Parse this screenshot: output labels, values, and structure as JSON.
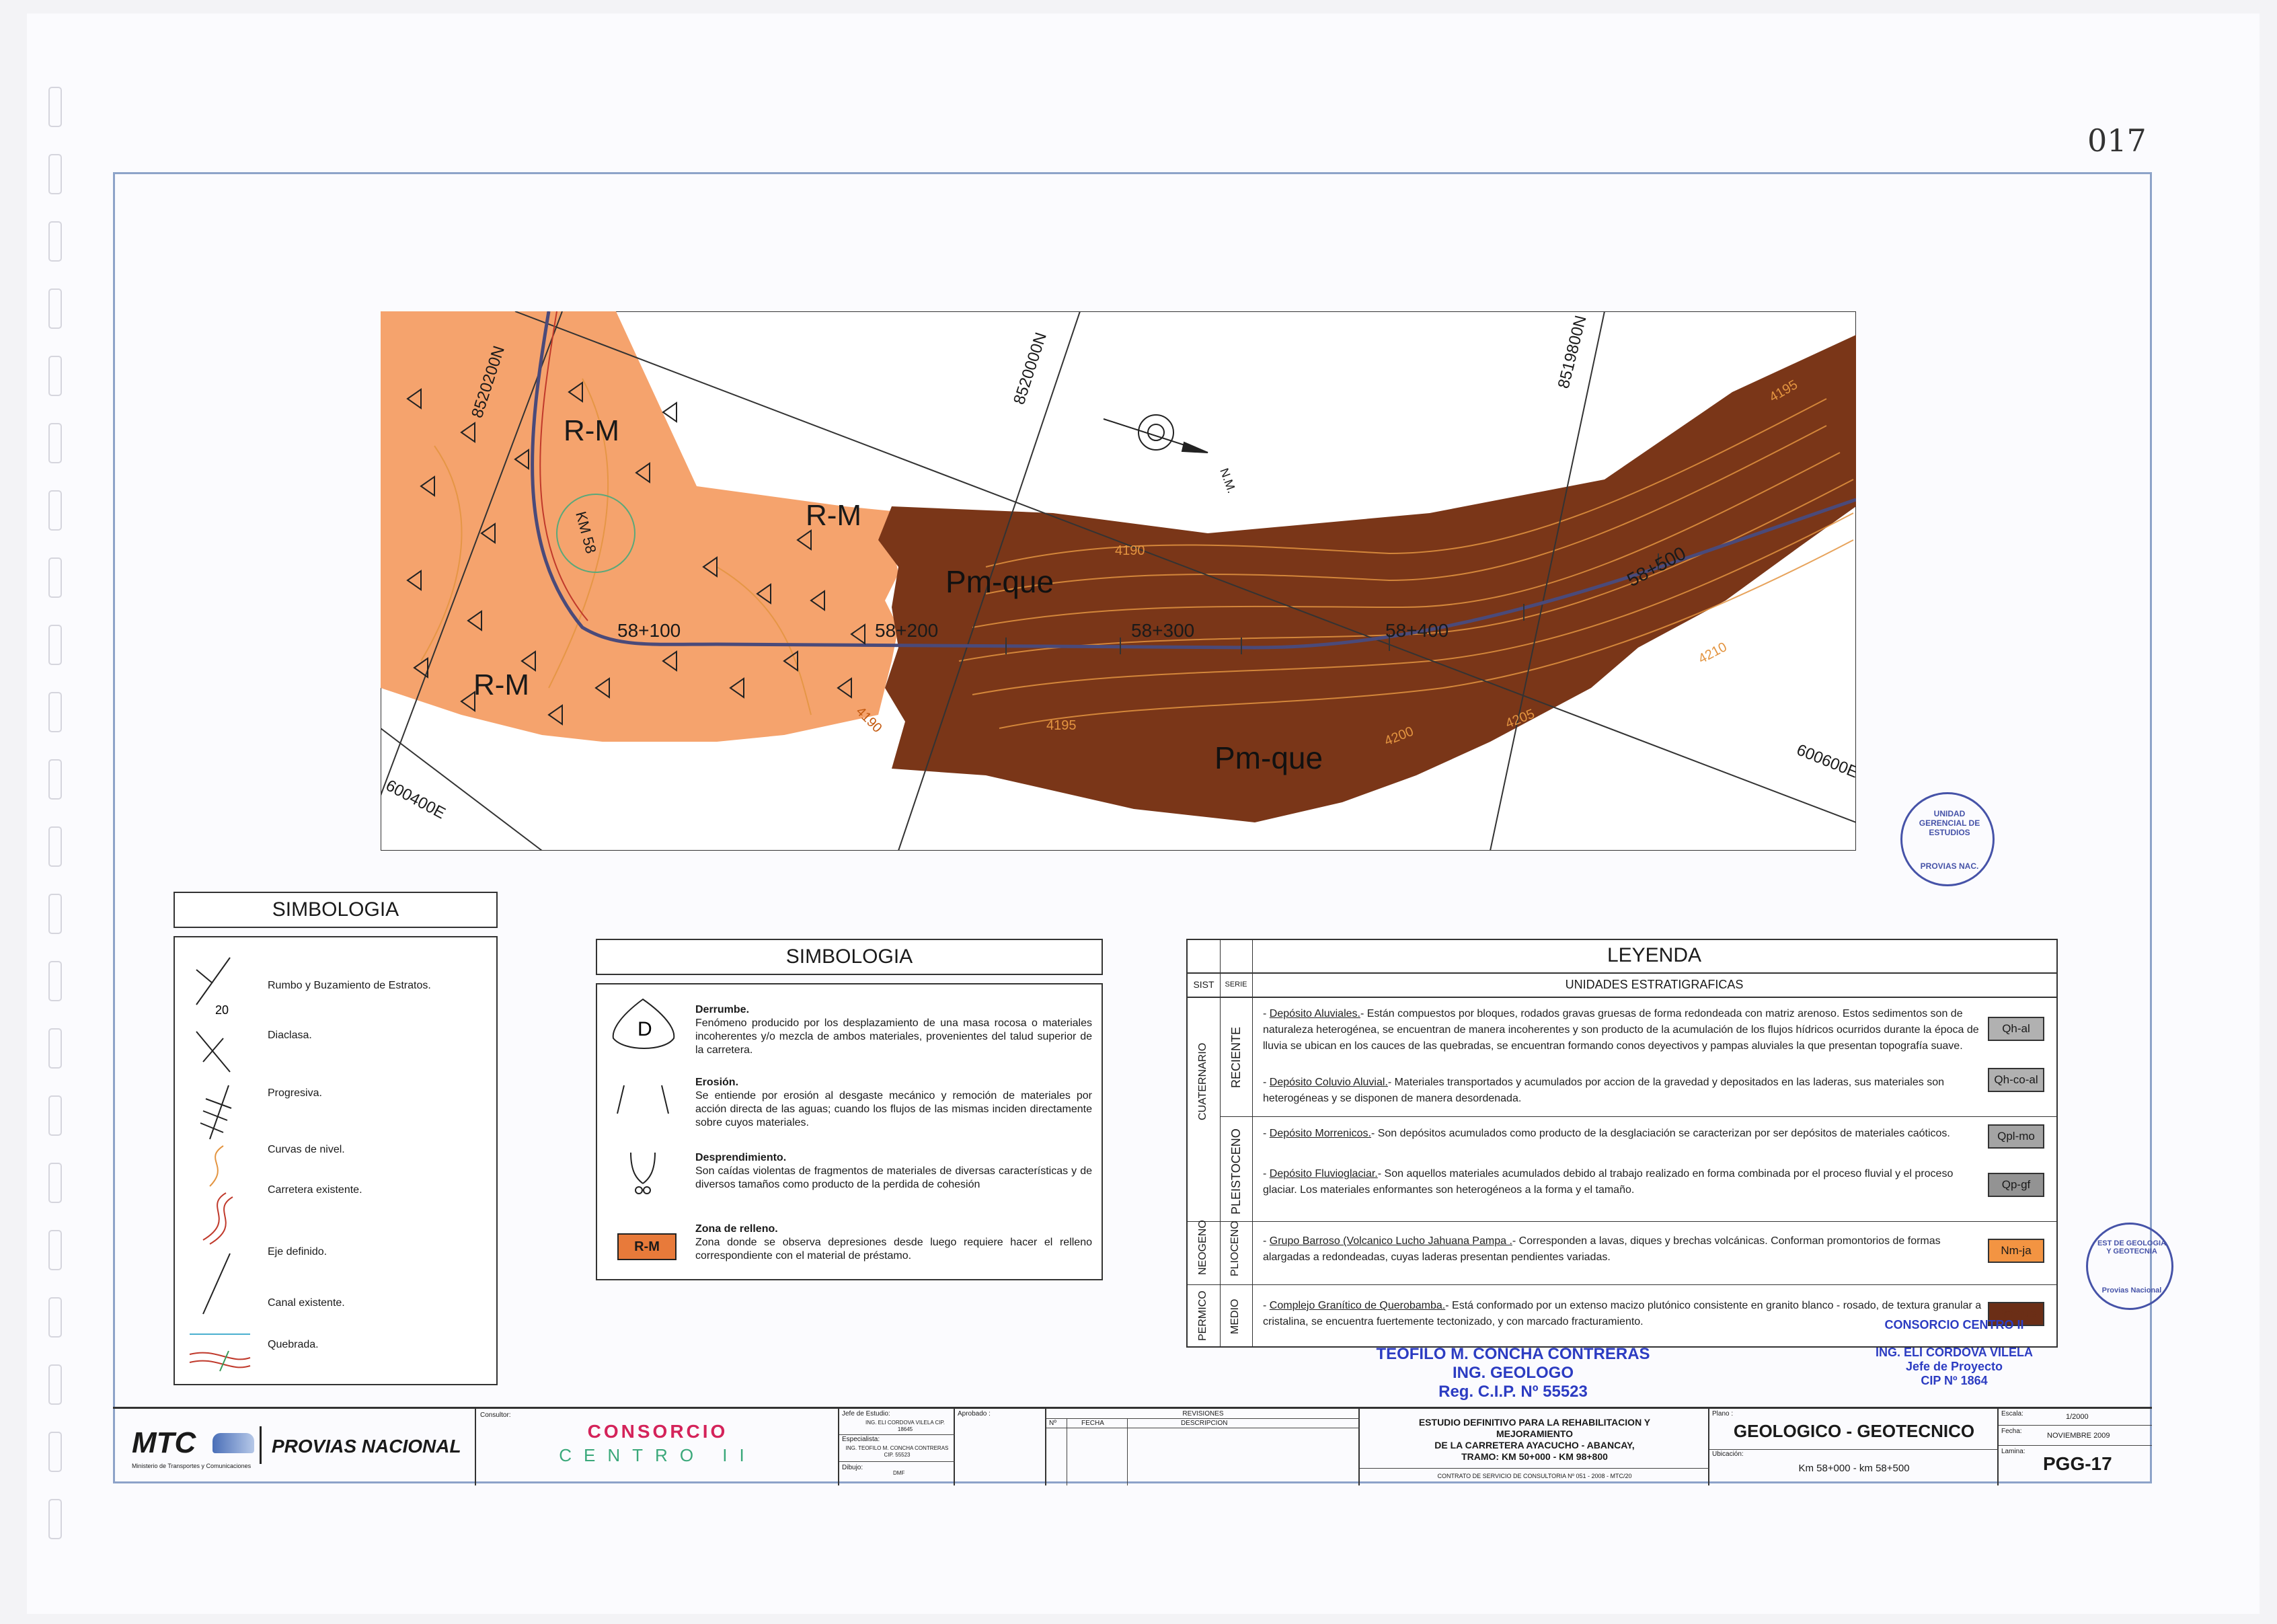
{
  "page": {
    "number": "017"
  },
  "map": {
    "units": {
      "rm": "R-M",
      "pm": "Pm-que"
    },
    "grid_labels": [
      "8520200N",
      "8520000N",
      "8519800N",
      "600400E",
      "600600E"
    ],
    "progressives": [
      "58+100",
      "58+200",
      "58+300",
      "58+400",
      "58+500"
    ],
    "km_marker": "KM 58",
    "contours": [
      "4190",
      "4195",
      "4195",
      "4200",
      "4205",
      "4190",
      "4210",
      "4195"
    ],
    "north": "N.M.",
    "colors": {
      "rm": "#f5a36d",
      "pm": "#7a3618",
      "contour": "#e39440"
    }
  },
  "symbology_left": {
    "title": "SIMBOLOGIA",
    "items": [
      {
        "icon": "strike-dip-icon",
        "label": "Rumbo y Buzamiento de Estratos.",
        "value": "20"
      },
      {
        "icon": "joint-icon",
        "label": "Diaclasa."
      },
      {
        "icon": "progressive-icon",
        "label": "Progresiva."
      },
      {
        "icon": "contour-icon",
        "label": "Curvas de nivel."
      },
      {
        "icon": "road-icon",
        "label": "Carretera existente."
      },
      {
        "icon": "axis-icon",
        "label": "Eje definido."
      },
      {
        "icon": "canal-icon",
        "label": "Canal existente."
      },
      {
        "icon": "stream-icon",
        "label": "Quebrada."
      }
    ]
  },
  "symbology_mid": {
    "title": "SIMBOLOGIA",
    "items": [
      {
        "icon": "landslide-icon",
        "symbol": "D",
        "title": "Derrumbe.",
        "text": "Fenómeno producido por los desplazamiento de una masa rocosa o materiales incoherentes y/o mezcla de ambos materiales, provenientes del talud superior de la carretera."
      },
      {
        "icon": "erosion-icon",
        "title": "Erosión.",
        "text": "Se entiende por erosión al desgaste mecánico y remoción de materiales por acción directa de las aguas; cuando los flujos de las mismas inciden directamente sobre cuyos materiales."
      },
      {
        "icon": "rockfall-icon",
        "title": "Desprendimiento.",
        "text": "Son caídas violentas de fragmentos de materiales de diversas características y de diversos tamaños como producto de la perdida de cohesión"
      },
      {
        "icon": "fill-zone-icon",
        "symbol": "R-M",
        "title": "Zona de relleno.",
        "text": "Zona donde se observa depresiones desde luego requiere hacer el relleno correspondiente con el material  de préstamo."
      }
    ]
  },
  "legend": {
    "title": "LEYENDA",
    "col_sist": "SIST",
    "col_serie": "SERIE",
    "col_units": "UNIDADES ESTRATIGRAFICAS",
    "systems": [
      "CUATERNARIO",
      "NEOGENO",
      "PERMICO"
    ],
    "series": [
      "RECIENTE",
      "PLEISTOCENO",
      "PLIOCENO",
      "MEDIO"
    ],
    "rows": [
      {
        "name": "Depósito Aluviales.",
        "text": "Están compuestos por bloques, rodados gravas gruesas de forma redondeada con matriz arenoso. Estos sedimentos son de naturaleza heterogénea, se encuentran de manera incoherentes y son producto de la acumulación de los flujos hídricos ocurridos durante la época  de lluvia  se ubican en los cauces de las quebradas, se encuentran formando conos deyectivos y pampas aluviales la que presentan topografía suave.",
        "code": "Qh-al",
        "color": "#b1b1b1"
      },
      {
        "name": "Depósito Coluvio Aluvial.",
        "text": "Materiales transportados y acumulados por accion de la gravedad y depositados en las laderas, sus materiales son heterogéneas y se disponen de manera desordenada.",
        "code": "Qh-co-al",
        "color": "#b1b1b1"
      },
      {
        "name": "Depósito Morrenicos.",
        "text": "Son depósitos acumulados como producto de la desglaciación se caracterizan por ser depósitos de materiales caóticos.",
        "code": "Qpl-mo",
        "color": "#a4a4a4"
      },
      {
        "name": "Depósito Fluvioglaciar.",
        "text": "Son aquellos materiales acumulados debido al trabajo realizado en forma combinada por el proceso fluvial y el proceso glaciar. Los materiales enformantes son heterogéneos a la forma y el tamaño.",
        "code": "Qp-gf",
        "color": "#939393"
      },
      {
        "name": "Grupo Barroso (Volcanico Lucho Jahuana Pampa .",
        "text": "Corresponden a lavas, diques y brechas volcánicas. Conforman promontorios de formas alargadas a redondeadas, cuyas laderas presentan pendientes variadas.",
        "code": "Nm-ja",
        "color": "#f39442"
      },
      {
        "name": "Complejo Granítico de Querobamba.",
        "text": "Está conformado por un extenso macizo plutónico consistente en granito blanco - rosado, de textura granular a cristalina, se encuentra fuertemente tectonizado, y con marcado fracturamiento.",
        "code": "Pm-que",
        "color": "#6b2e16"
      }
    ]
  },
  "stamps": {
    "unit_stamp": "UNIDAD GERENCIAL DE ESTUDIOS",
    "unit_stamp_sub": "PROVIAS NAC.",
    "geo_stamp": "EST DE GEOLOGIA Y GEOTECNIA",
    "geo_stamp_sub": "Provias Nacional",
    "signature_1": [
      "TEOFILO M. CONCHA CONTRERAS",
      "ING. GEOLOGO",
      "Reg. C.I.P. Nº 55523"
    ],
    "signature_2": [
      "CONSORCIO CENTRO II",
      "ING. ELI CORDOVA VILELA",
      "Jefe de Proyecto",
      "CIP Nº 1864"
    ]
  },
  "title_block": {
    "mtc": "MTC",
    "mtc_sub": "Ministerio de Transportes y Comunicaciones",
    "provias": "PROVIAS NACIONAL",
    "consultor_label": "Consultor:",
    "consorcio": "CONSORCIO",
    "centro": "CENTRO II",
    "jefe_label": "Jefe de Estudio:",
    "jefe_value": "ING. ELI CORDOVA VILELA CIP. 18645",
    "especialista_label": "Especialista:",
    "especialista_value": "ING. TEOFILO M. CONCHA CONTRERAS CIP. 55523",
    "dibujo_label": "Dibujo:",
    "dibujo_value": "DMF",
    "aprobado_label": "Aprobado :",
    "revisiones": "REVISIONES",
    "rev_n": "Nº",
    "rev_fecha": "FECHA",
    "rev_desc": "DESCRIPCION",
    "study": [
      "ESTUDIO DEFINITIVO PARA LA REHABILITACION Y",
      "MEJORAMIENTO",
      "DE LA CARRETERA AYACUCHO - ABANCAY,",
      "TRAMO: KM 50+000 - KM 98+800"
    ],
    "contract": "CONTRATO DE SERVICIO DE CONSULTORIA  Nº 051 - 2008 - MTC/20",
    "plano_label": "Plano :",
    "plano": "GEOLOGICO - GEOTECNICO",
    "ubicacion_label": "Ubicación:",
    "ubicacion": "Km 58+000 - km 58+500",
    "escala_label": "Escala:",
    "escala": "1/2000",
    "fecha_label": "Fecha:",
    "fecha": "NOVIEMBRE 2009",
    "lamina_label": "Lamina:",
    "lamina": "PGG-17"
  }
}
